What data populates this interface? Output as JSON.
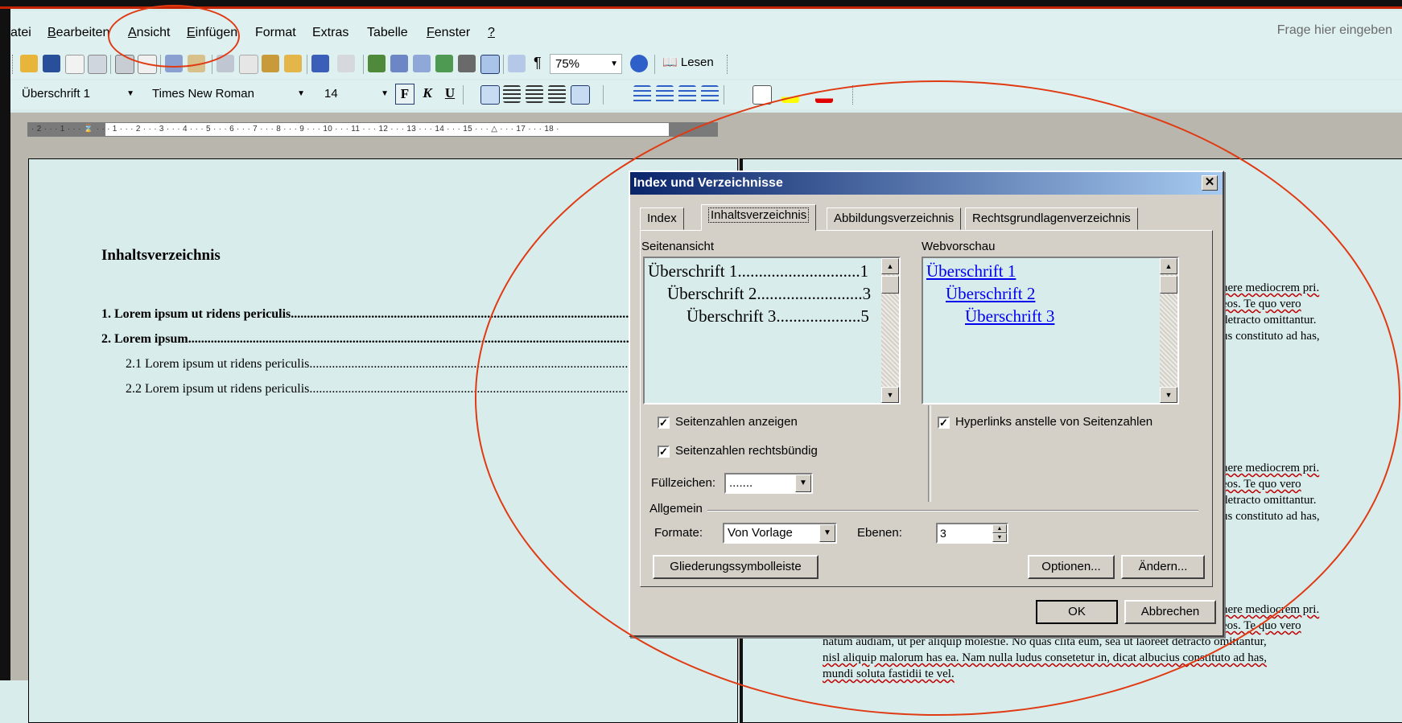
{
  "menu": {
    "items": [
      "atei",
      "Bearbeiten",
      "Ansicht",
      "Einfügen",
      "Format",
      "Extras",
      "Tabelle",
      "Fenster",
      "?"
    ],
    "underline": [
      "",
      "B",
      "A",
      "E",
      "t",
      "x",
      "l",
      "F",
      "?"
    ],
    "help_placeholder": "Frage hier eingeben"
  },
  "toolbar": {
    "zoom": "75%",
    "read_label": "Lesen",
    "style": "Überschrift 1",
    "font": "Times New Roman",
    "size": "14",
    "bold": "F",
    "italic": "K",
    "underline": "U"
  },
  "ruler": {
    "numbers": "· 2 · · · 1 · · · ⌛ · · · 1 · · · 2 · · · 3 · · · 4 · · · 5 · · · 6 · · · 7 · · · 8 · · · 9 · · · 10 · · · 11 · · · 12 · · · 13 · · · 14 · · · 15 · · · △ · · · 17 · · · 18 ·"
  },
  "document": {
    "toc_title": "Inhaltsverzeichnis",
    "toc_entries": [
      "1. Lorem ipsum ut ridens periculis..........................................................................................................................",
      "2. Lorem ipsum.......................................................................................................................................................",
      "2.1 Lorem ipsum ut ridens periculis..............................................................................................................................",
      "2.2 Lorem ipsum ut ridens periculis.............................................................................................................................."
    ],
    "right_fragments": [
      [
        "nere mediocrem pri.",
        "eos. Te quo vero",
        "detracto omittantur.",
        "us constituto ad has,"
      ],
      [
        "nere mediocrem pri.",
        "eos. Te quo vero",
        "detracto omittantur.",
        "us constituto ad has,"
      ],
      [
        "nere mediocrem pri.",
        "eos. Te quo vero",
        "natum audiam, ut per aliquip molestie. No quas clita eum, sea ut laoreet detracto omittantur,",
        "nisl aliquip malorum has ea. Nam nulla ludus consetetur in, dicat albucius constituto ad has,",
        "mundi soluta fastidii te vel."
      ]
    ]
  },
  "dialog": {
    "title": "Index und Verzeichnisse",
    "tabs": [
      "Index",
      "Inhaltsverzeichnis",
      "Abbildungsverzeichnis",
      "Rechtsgrundlagenverzeichnis"
    ],
    "print_preview_label": "Seitenansicht",
    "web_preview_label": "Webvorschau",
    "print_preview": [
      {
        "text": "Überschrift 1.............................",
        "page": "1"
      },
      {
        "text": "Überschrift 2.........................",
        "page": "3"
      },
      {
        "text": "Überschrift 3....................",
        "page": "5"
      }
    ],
    "web_preview": [
      "Überschrift 1",
      "Überschrift 2",
      "Überschrift 3"
    ],
    "show_page_numbers": "Seitenzahlen anzeigen",
    "right_align_page_numbers": "Seitenzahlen rechtsbündig",
    "hyperlinks_label": "Hyperlinks anstelle von Seitenzahlen",
    "tab_leader_label": "Füllzeichen:",
    "tab_leader_value": ".......",
    "general_label": "Allgemein",
    "formats_label": "Formate:",
    "formats_value": "Von Vorlage",
    "levels_label": "Ebenen:",
    "levels_value": "3",
    "outline_toolbar_button": "Gliederungssymbolleiste",
    "options_button": "Optionen...",
    "modify_button": "Ändern...",
    "ok_button": "OK",
    "cancel_button": "Abbrechen"
  },
  "colors": {
    "annotation": "#e03a12",
    "title_bar_start": "#0a246a",
    "hyperlink": "#0000ee"
  }
}
